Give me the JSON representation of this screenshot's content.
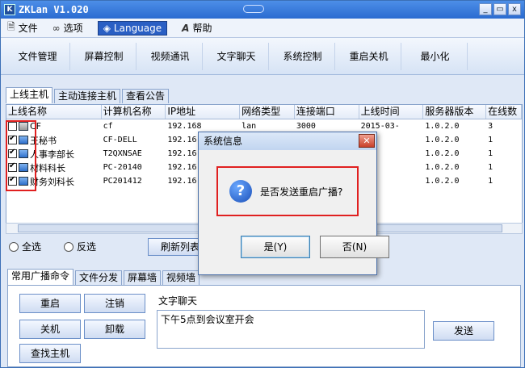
{
  "window": {
    "title": "ZKLan V1.020",
    "app_icon": "K"
  },
  "window_buttons": {
    "minimize": "_",
    "restore": "▭",
    "close": "x"
  },
  "menu": [
    {
      "label": "文件",
      "icon": "file-icon"
    },
    {
      "label": "选项",
      "icon": "glasses-icon"
    },
    {
      "label": "Language",
      "icon": "language-icon"
    },
    {
      "label": "帮助",
      "icon": "help-icon"
    }
  ],
  "toolbar": [
    "文件管理",
    "屏幕控制",
    "视频通讯",
    "文字聊天",
    "系统控制",
    "重启关机",
    "最小化"
  ],
  "host_tabs": [
    "上线主机",
    "主动连接主机",
    "查看公告"
  ],
  "grid": {
    "headers": [
      "上线名称",
      "计算机名称",
      "IP地址",
      "网络类型",
      "连接端口",
      "上线时间",
      "服务器版本",
      "在线数"
    ],
    "rows": [
      {
        "checked": false,
        "name": "CF",
        "computer": "cf",
        "ip": "192.168",
        "net": "lan",
        "port": "3000",
        "time": "2015-03-",
        "ver": "1.0.2.0",
        "online": "3"
      },
      {
        "checked": true,
        "name": "王秘书",
        "computer": "CF-DELL",
        "ip": "192.16",
        "net": "",
        "port": "",
        "time": "",
        "ver": "1.0.2.0",
        "online": "1"
      },
      {
        "checked": true,
        "name": "人事李部长",
        "computer": "T2QXNSAE",
        "ip": "192.16",
        "net": "",
        "port": "",
        "time": "",
        "ver": "1.0.2.0",
        "online": "1"
      },
      {
        "checked": true,
        "name": "材料科长",
        "computer": "PC-20140",
        "ip": "192.16",
        "net": "",
        "port": "",
        "time": "",
        "ver": "1.0.2.0",
        "online": "1"
      },
      {
        "checked": true,
        "name": "财务刘科长",
        "computer": "PC201412",
        "ip": "192.16",
        "net": "",
        "port": "",
        "time": "",
        "ver": "1.0.2.0",
        "online": "1"
      }
    ]
  },
  "select": {
    "all": "全选",
    "invert": "反选",
    "refresh": "刷新列表"
  },
  "bottom_tabs": [
    "常用广播命令",
    "文件分发",
    "屏幕墙",
    "视频墙"
  ],
  "commands": {
    "restart": "重启",
    "logoff": "注销",
    "shutdown": "关机",
    "uninstall": "卸载",
    "find_host": "查找主机"
  },
  "chat": {
    "label": "文字聊天",
    "message": "下午5点到会议室开会",
    "send": "发送"
  },
  "dialog": {
    "title": "系统信息",
    "close": "✕",
    "message": "是否发送重启广播?",
    "yes": "是(Y)",
    "no": "否(N)"
  }
}
